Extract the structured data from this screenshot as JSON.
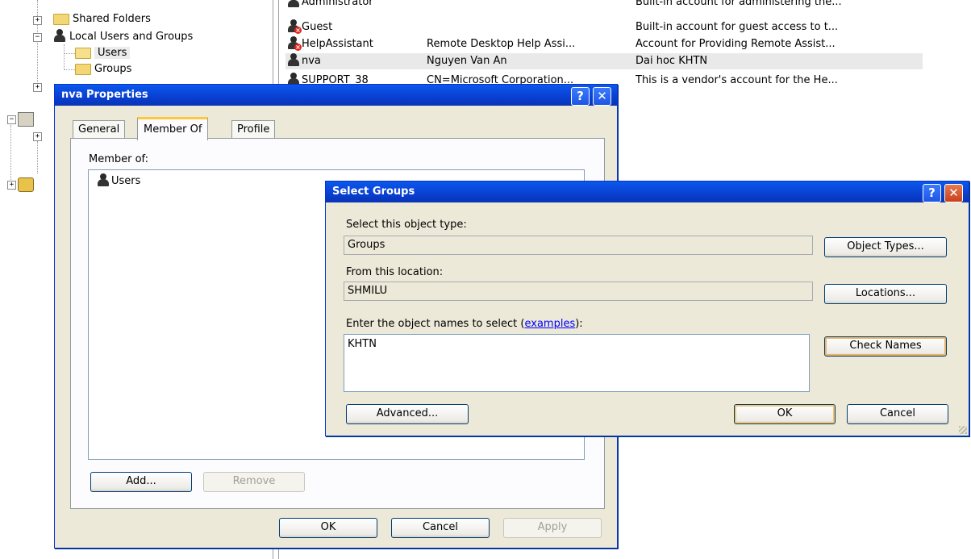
{
  "tree": {
    "shared_folders": "Shared Folders",
    "local_users_groups": "Local Users and Groups",
    "users": "Users",
    "groups": "Groups"
  },
  "list": {
    "rows": [
      {
        "name": "Administrator",
        "full_name": "",
        "description": "Built-in account for administering the..."
      },
      {
        "name": "Guest",
        "full_name": "",
        "description": "Built-in account for guest access to t..."
      },
      {
        "name": "HelpAssistant",
        "full_name": "Remote Desktop Help Assi...",
        "description": "Account for Providing Remote Assist..."
      },
      {
        "name": "nva",
        "full_name": "Nguyen Van An",
        "description": "Dai hoc KHTN"
      },
      {
        "name": "SUPPORT_38",
        "full_name": "CN=Microsoft Corporation...",
        "description": "This is a vendor's account for the He..."
      }
    ]
  },
  "properties_dialog": {
    "title": "nva Properties",
    "help_glyph": "?",
    "close_glyph": "✕",
    "tabs": [
      "General",
      "Member Of",
      "Profile"
    ],
    "member_of_label": "Member of:",
    "members": [
      "Users"
    ],
    "add_button": "Add...",
    "remove_button": "Remove",
    "ok_button": "OK",
    "cancel_button": "Cancel",
    "apply_button": "Apply"
  },
  "select_groups_dialog": {
    "title": "Select Groups",
    "help_glyph": "?",
    "close_glyph": "✕",
    "object_type_label": "Select this object type:",
    "object_type_value": "Groups",
    "object_types_button": "Object Types...",
    "location_label": "From this location:",
    "location_value": "SHMILU",
    "locations_button": "Locations...",
    "names_label_prefix": "Enter the object names to select (",
    "names_label_link": "examples",
    "names_label_suffix": "):",
    "names_value": "KHTN",
    "check_names_button": "Check Names",
    "advanced_button": "Advanced...",
    "ok_button": "OK",
    "cancel_button": "Cancel"
  },
  "colors": {
    "titlebar": "#0a45d8",
    "dialog_face": "#ece9d8",
    "close_button": "#c8401a"
  }
}
